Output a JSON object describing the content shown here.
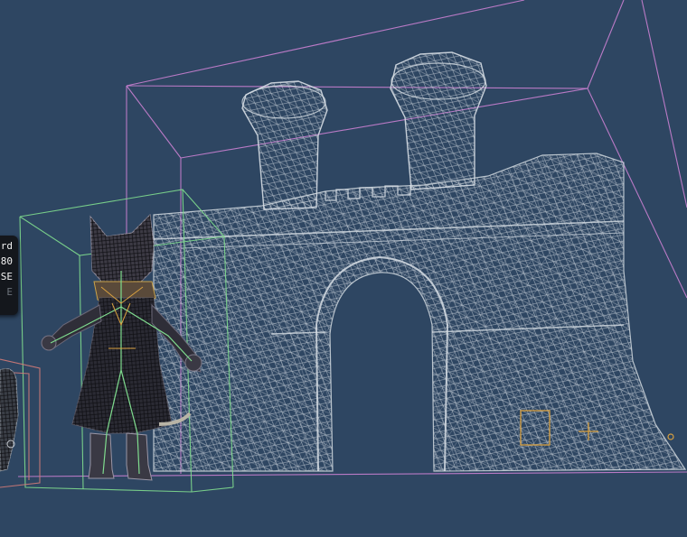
{
  "viewport": {
    "background_color": "#2e4662",
    "mode": "wireframe",
    "selection_box_colors": {
      "castle": "#c97fd0",
      "character_selected": "#7fdc8e",
      "character_other": "#d27a78"
    }
  },
  "scene_objects": [
    {
      "name": "castle-gate",
      "render": "wireframe",
      "color": "#c8d0d8"
    },
    {
      "name": "cat-knight-character",
      "render": "textured-wireframe",
      "color": "#2a2a33"
    },
    {
      "name": "secondary-character",
      "render": "textured-wireframe",
      "color": "#55585e"
    }
  ],
  "tooltip": {
    "lines": [
      "rd",
      "80",
      "SE",
      "E"
    ]
  }
}
